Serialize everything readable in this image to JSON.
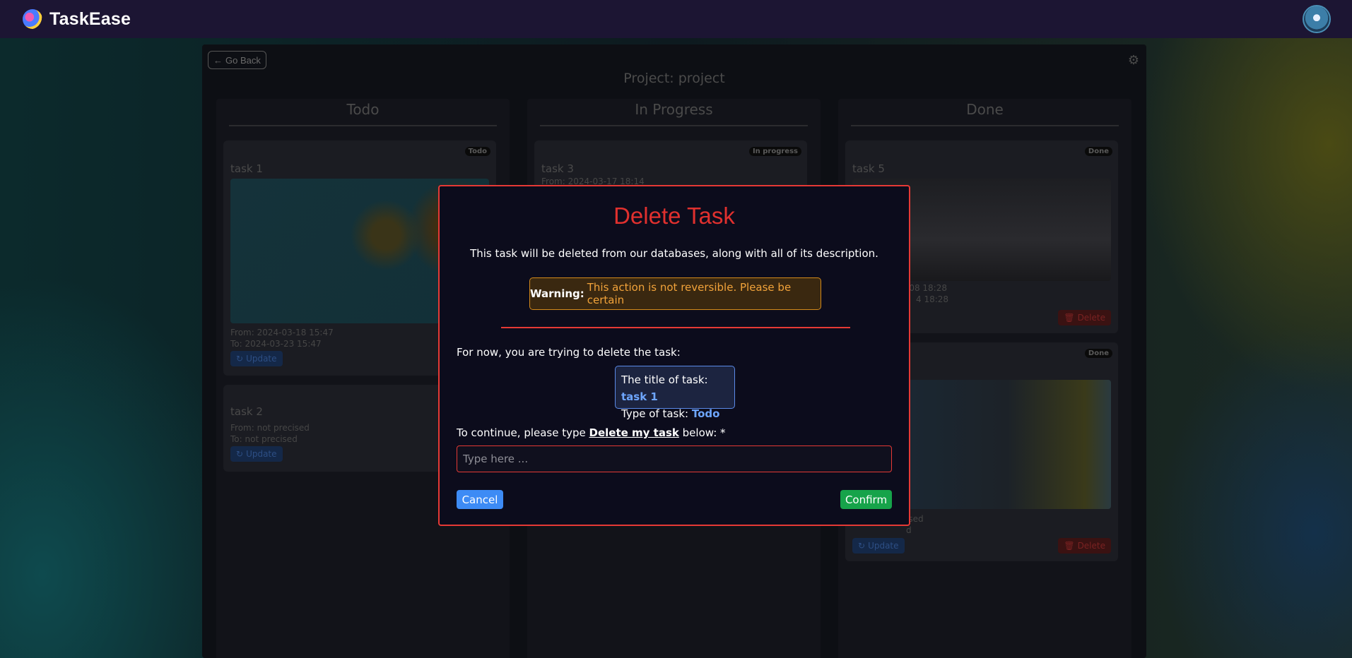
{
  "navbar": {
    "brand": "TaskEase"
  },
  "board": {
    "go_back_label": "Go Back",
    "project_title": "Project: project",
    "columns": [
      {
        "title": "Todo"
      },
      {
        "title": "In Progress"
      },
      {
        "title": "Done"
      }
    ],
    "cards": {
      "task1": {
        "badge": "Todo",
        "title": "task 1",
        "from": "From: 2024-03-18 15:47",
        "to": "To: 2024-03-23 15:47",
        "update_label": "Update"
      },
      "task2": {
        "title": "task 2",
        "from": "From: not precised",
        "to": "To: not precised",
        "update_label": "Update"
      },
      "task3": {
        "badge": "In progress",
        "title": "task 3",
        "from": "From: 2024-03-17 18:14"
      },
      "task5": {
        "badge": "Done",
        "title": "task 5",
        "from": "-08 18:28",
        "to": "4 18:28",
        "delete_label": "Delete"
      },
      "task_done2": {
        "badge": "Done",
        "from": "ised",
        "to": "d",
        "update_label": "Update",
        "delete_label": "Delete"
      }
    }
  },
  "modal": {
    "title": "Delete Task",
    "description": "This task will be deleted from our databases, along with all of its description.",
    "warning_label": "Warning:",
    "warning_text": "This action is not reversible. Please be certain",
    "now_text": "For now, you are trying to delete the task:",
    "task_title_label": "The title of task:",
    "task_title_value": "task 1",
    "task_type_label": "Type of task:",
    "task_type_value": "Todo",
    "continue_prefix": "To continue, please type",
    "continue_keyword": "Delete my task",
    "continue_suffix": "below: *",
    "input_placeholder": "Type here ...",
    "input_value": "",
    "cancel_label": "Cancel",
    "confirm_label": "Confirm"
  },
  "colors": {
    "accent_red": "#e53935",
    "warning_orange": "#f2a33a",
    "info_blue": "#6ea6ff",
    "cancel_blue": "#3d8bf5",
    "confirm_green": "#16a34a",
    "navbar_bg": "#1c1533"
  }
}
